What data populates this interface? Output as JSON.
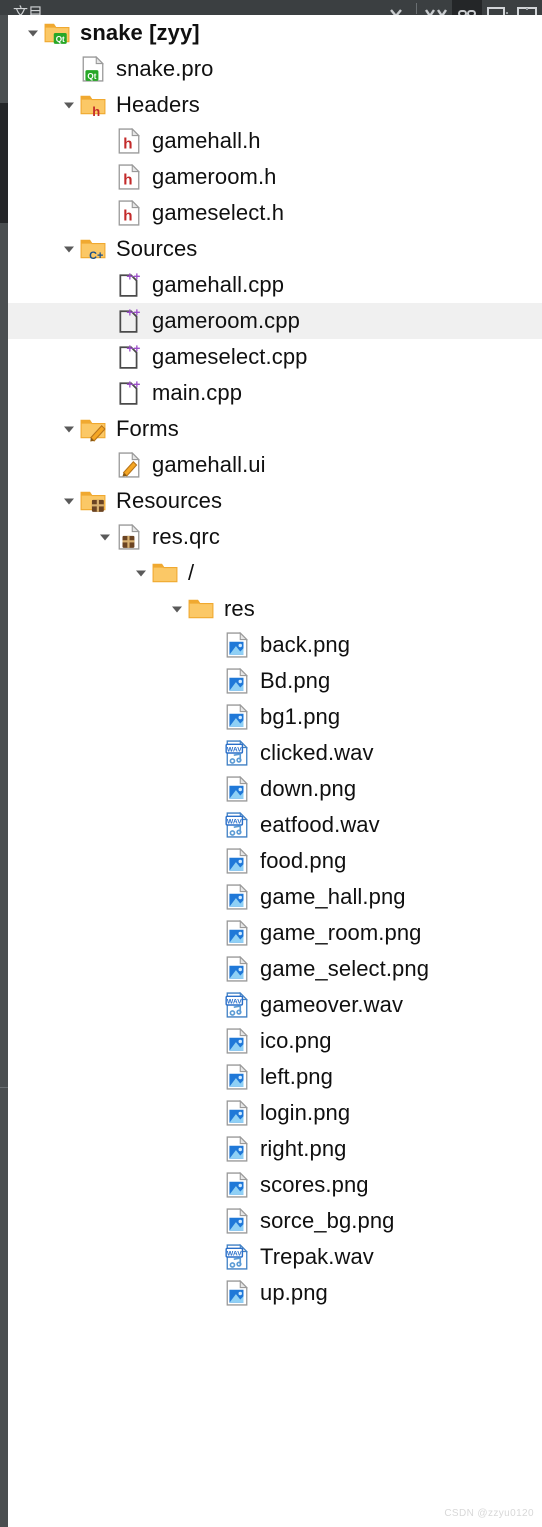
{
  "toolbar": {
    "partial_text": "文目",
    "buttons": [
      {
        "name": "chevron-down-button",
        "icon": "chevron-down-icon",
        "active": false
      },
      {
        "name": "navigate-backforward-button",
        "icon": "double-chevron-icon",
        "active": false
      },
      {
        "name": "link-editors-button",
        "icon": "link-icon",
        "active": true
      },
      {
        "name": "split-horizontal-button",
        "icon": "split-horizontal-icon",
        "active": false
      },
      {
        "name": "split-vertical-button",
        "icon": "split-vertical-icon",
        "active": false
      }
    ]
  },
  "colors": {
    "toolbar_bg": "#3b3f41",
    "toolbar_active": "#242628",
    "rail_bg": "#4a4e50",
    "selection": "#f0f0f0",
    "folder": "#fbc866",
    "folder_dark": "#f0a930",
    "qt_green": "#27a727",
    "header_red": "#c32a2a",
    "cpp_purple": "#9b4fc8",
    "image_blue": "#1f78d8",
    "wav_blue": "#2a6fc9",
    "resource_brown": "#6b4423",
    "text": "#101010",
    "watermark": "#d8d8d8"
  },
  "tree": {
    "rows": [
      {
        "label": "snake [zyy]",
        "depth": 0,
        "icon": "folder-qt-icon",
        "arrow": "expanded",
        "bold": true,
        "selected": false
      },
      {
        "label": "snake.pro",
        "depth": 1,
        "icon": "file-qt-icon",
        "arrow": "none",
        "bold": false,
        "selected": false
      },
      {
        "label": "Headers",
        "depth": 1,
        "icon": "folder-header-icon",
        "arrow": "expanded",
        "bold": false,
        "selected": false
      },
      {
        "label": "gamehall.h",
        "depth": 2,
        "icon": "file-header-icon",
        "arrow": "none",
        "bold": false,
        "selected": false
      },
      {
        "label": "gameroom.h",
        "depth": 2,
        "icon": "file-header-icon",
        "arrow": "none",
        "bold": false,
        "selected": false
      },
      {
        "label": "gameselect.h",
        "depth": 2,
        "icon": "file-header-icon",
        "arrow": "none",
        "bold": false,
        "selected": false
      },
      {
        "label": "Sources",
        "depth": 1,
        "icon": "folder-cpp-icon",
        "arrow": "expanded",
        "bold": false,
        "selected": false
      },
      {
        "label": "gamehall.cpp",
        "depth": 2,
        "icon": "file-cpp-icon",
        "arrow": "none",
        "bold": false,
        "selected": false
      },
      {
        "label": "gameroom.cpp",
        "depth": 2,
        "icon": "file-cpp-icon",
        "arrow": "none",
        "bold": false,
        "selected": true
      },
      {
        "label": "gameselect.cpp",
        "depth": 2,
        "icon": "file-cpp-icon",
        "arrow": "none",
        "bold": false,
        "selected": false
      },
      {
        "label": "main.cpp",
        "depth": 2,
        "icon": "file-cpp-icon",
        "arrow": "none",
        "bold": false,
        "selected": false
      },
      {
        "label": "Forms",
        "depth": 1,
        "icon": "folder-form-icon",
        "arrow": "expanded",
        "bold": false,
        "selected": false
      },
      {
        "label": "gamehall.ui",
        "depth": 2,
        "icon": "file-form-icon",
        "arrow": "none",
        "bold": false,
        "selected": false
      },
      {
        "label": "Resources",
        "depth": 1,
        "icon": "folder-res-icon",
        "arrow": "expanded",
        "bold": false,
        "selected": false
      },
      {
        "label": "res.qrc",
        "depth": 2,
        "icon": "file-qrc-icon",
        "arrow": "expanded",
        "bold": false,
        "selected": false
      },
      {
        "label": "/",
        "depth": 3,
        "icon": "folder-plain-icon",
        "arrow": "expanded",
        "bold": false,
        "selected": false
      },
      {
        "label": "res",
        "depth": 4,
        "icon": "folder-plain-icon",
        "arrow": "expanded",
        "bold": false,
        "selected": false
      },
      {
        "label": "back.png",
        "depth": 5,
        "icon": "file-image-icon",
        "arrow": "none",
        "bold": false,
        "selected": false
      },
      {
        "label": "Bd.png",
        "depth": 5,
        "icon": "file-image-icon",
        "arrow": "none",
        "bold": false,
        "selected": false
      },
      {
        "label": "bg1.png",
        "depth": 5,
        "icon": "file-image-icon",
        "arrow": "none",
        "bold": false,
        "selected": false
      },
      {
        "label": "clicked.wav",
        "depth": 5,
        "icon": "file-wav-icon",
        "arrow": "none",
        "bold": false,
        "selected": false
      },
      {
        "label": "down.png",
        "depth": 5,
        "icon": "file-image-icon",
        "arrow": "none",
        "bold": false,
        "selected": false
      },
      {
        "label": "eatfood.wav",
        "depth": 5,
        "icon": "file-wav-icon",
        "arrow": "none",
        "bold": false,
        "selected": false
      },
      {
        "label": "food.png",
        "depth": 5,
        "icon": "file-image-icon",
        "arrow": "none",
        "bold": false,
        "selected": false
      },
      {
        "label": "game_hall.png",
        "depth": 5,
        "icon": "file-image-icon",
        "arrow": "none",
        "bold": false,
        "selected": false
      },
      {
        "label": "game_room.png",
        "depth": 5,
        "icon": "file-image-icon",
        "arrow": "none",
        "bold": false,
        "selected": false
      },
      {
        "label": "game_select.png",
        "depth": 5,
        "icon": "file-image-icon",
        "arrow": "none",
        "bold": false,
        "selected": false
      },
      {
        "label": "gameover.wav",
        "depth": 5,
        "icon": "file-wav-icon",
        "arrow": "none",
        "bold": false,
        "selected": false
      },
      {
        "label": "ico.png",
        "depth": 5,
        "icon": "file-image-icon",
        "arrow": "none",
        "bold": false,
        "selected": false
      },
      {
        "label": "left.png",
        "depth": 5,
        "icon": "file-image-icon",
        "arrow": "none",
        "bold": false,
        "selected": false
      },
      {
        "label": "login.png",
        "depth": 5,
        "icon": "file-image-icon",
        "arrow": "none",
        "bold": false,
        "selected": false
      },
      {
        "label": "right.png",
        "depth": 5,
        "icon": "file-image-icon",
        "arrow": "none",
        "bold": false,
        "selected": false
      },
      {
        "label": "scores.png",
        "depth": 5,
        "icon": "file-image-icon",
        "arrow": "none",
        "bold": false,
        "selected": false
      },
      {
        "label": "sorce_bg.png",
        "depth": 5,
        "icon": "file-image-icon",
        "arrow": "none",
        "bold": false,
        "selected": false
      },
      {
        "label": "Trepak.wav",
        "depth": 5,
        "icon": "file-wav-icon",
        "arrow": "none",
        "bold": false,
        "selected": false
      },
      {
        "label": "up.png",
        "depth": 5,
        "icon": "file-image-icon",
        "arrow": "none",
        "bold": false,
        "selected": false
      }
    ]
  },
  "watermark": {
    "text": "CSDN @zzyu0120"
  }
}
